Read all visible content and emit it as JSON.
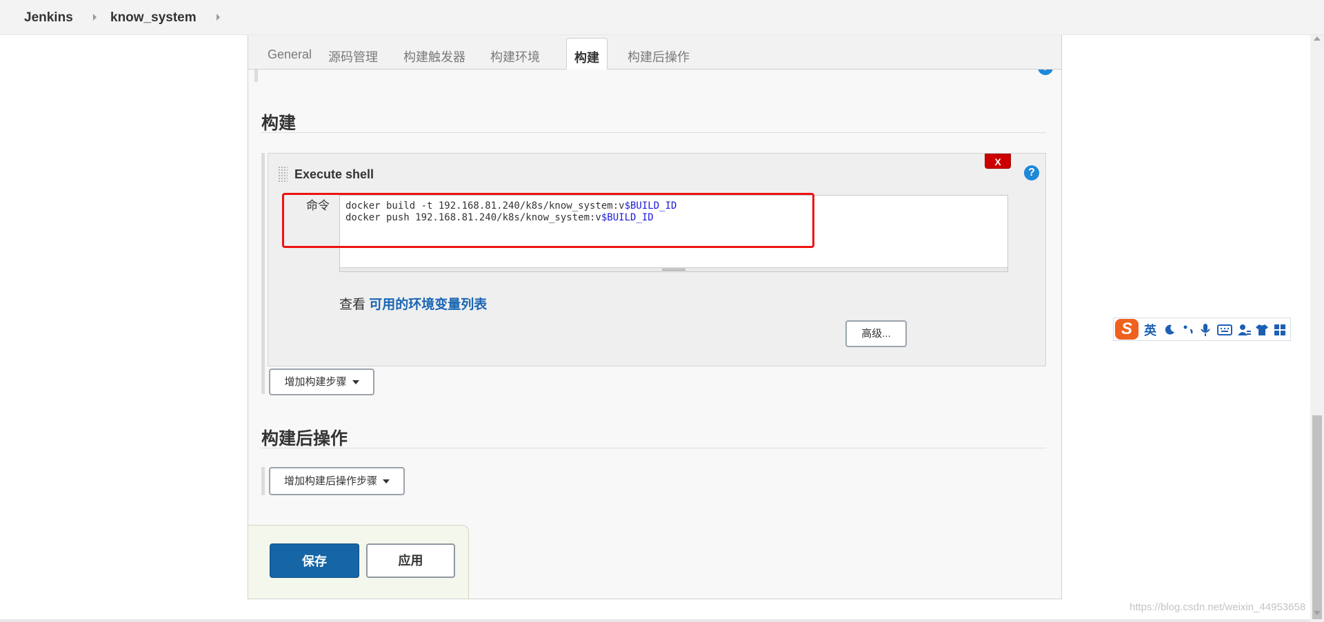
{
  "breadcrumb": {
    "items": [
      "Jenkins",
      "know_system"
    ]
  },
  "tabs": [
    {
      "label": "General",
      "active": false
    },
    {
      "label": "源码管理",
      "active": false
    },
    {
      "label": "构建触发器",
      "active": false
    },
    {
      "label": "构建环境",
      "active": false
    },
    {
      "label": "构建",
      "active": true
    },
    {
      "label": "构建后操作",
      "active": false
    }
  ],
  "build_section": {
    "title": "构建",
    "step": {
      "title": "Execute shell",
      "close_label": "X",
      "help_label": "?",
      "command_label": "命令",
      "command_lines": [
        {
          "text": "docker build -t 192.168.81.240/k8s/know_system:v",
          "var": "$BUILD_ID"
        },
        {
          "text": "docker push 192.168.81.240/k8s/know_system:v",
          "var": "$BUILD_ID"
        }
      ],
      "env_prefix": "查看 ",
      "env_link": "可用的环境变量列表",
      "advanced_label": "高级..."
    },
    "add_step_label": "增加构建步骤"
  },
  "post_build_section": {
    "title": "构建后操作",
    "add_step_label": "增加构建后操作步骤"
  },
  "actions": {
    "save_label": "保存",
    "apply_label": "应用"
  },
  "ime": {
    "logo": "S",
    "mode": "英"
  },
  "watermark": "https://blog.csdn.net/weixin_44953658",
  "colors": {
    "primary": "#1665a6",
    "link": "#1a66b3",
    "delete": "#cc0000",
    "highlight": "#ee1111",
    "help": "#1e88d9"
  }
}
